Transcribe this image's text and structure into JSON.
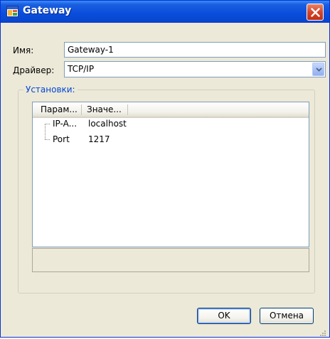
{
  "window": {
    "title": "Gateway",
    "icon": "app-window-icon",
    "close_icon": "close-icon"
  },
  "form": {
    "name_label": "Имя:",
    "name_value": "Gateway-1",
    "driver_label": "Драйвер:",
    "driver_value": "TCP/IP"
  },
  "settings": {
    "group_title": "Установки:",
    "columns": [
      "Парам...",
      "Значе..."
    ],
    "rows": [
      {
        "param": "IP-A...",
        "value": "localhost"
      },
      {
        "param": "Port",
        "value": "1217"
      }
    ]
  },
  "buttons": {
    "ok": "OK",
    "cancel": "Отмена"
  },
  "colors": {
    "title_blue": "#0a4ddc",
    "group_title": "#0046d5",
    "close_red": "#d4452a",
    "dialog_bg": "#ece9d8"
  }
}
